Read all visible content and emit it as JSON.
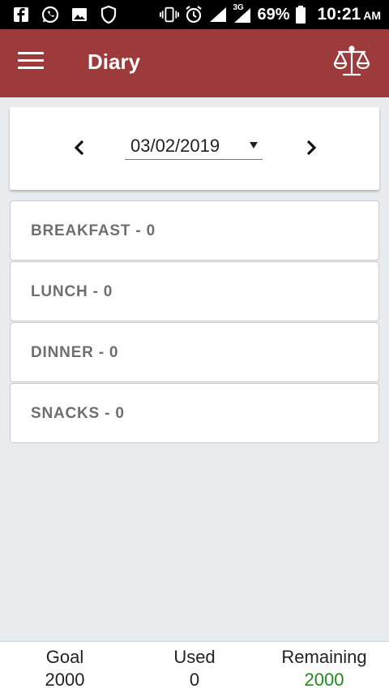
{
  "status_bar": {
    "battery_pct": "69%",
    "network": "3G",
    "time": "10:21",
    "ampm": "AM"
  },
  "app_bar": {
    "title": "Diary"
  },
  "date_picker": {
    "date": "03/02/2019"
  },
  "meals": [
    {
      "label": "BREAKFAST - 0"
    },
    {
      "label": "LUNCH - 0"
    },
    {
      "label": "DINNER - 0"
    },
    {
      "label": "SNACKS - 0"
    }
  ],
  "footer": {
    "goal_label": "Goal",
    "goal_value": "2000",
    "used_label": "Used",
    "used_value": "0",
    "remaining_label": "Remaining",
    "remaining_value": "2000"
  },
  "colors": {
    "app_bar": "#9c3a3c",
    "background": "#e9ecef",
    "remaining_value": "#1d8b1d"
  }
}
